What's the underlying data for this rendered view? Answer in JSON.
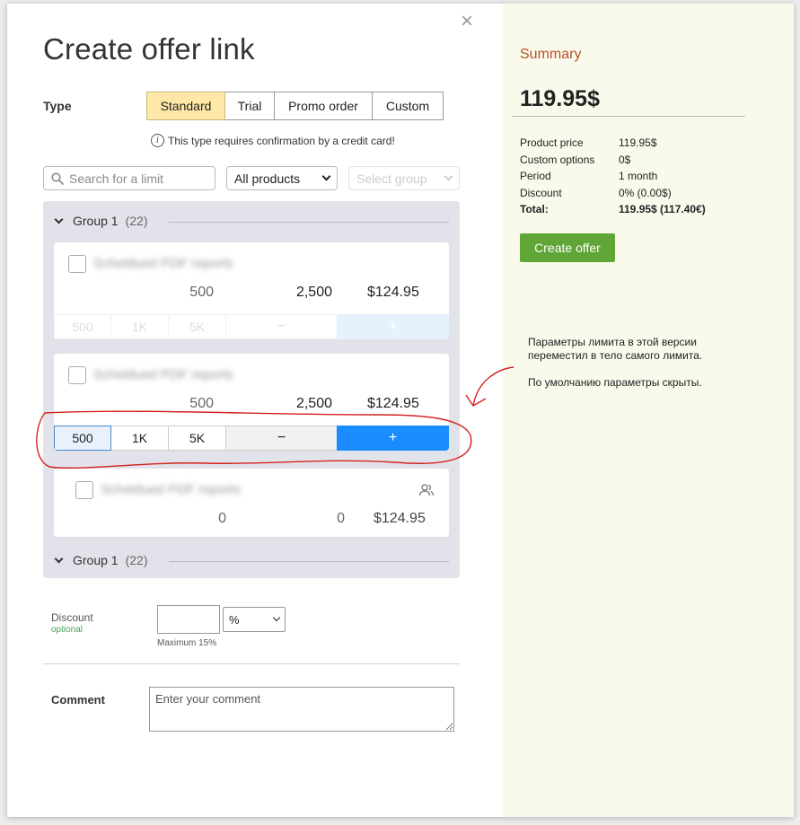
{
  "modal": {
    "close": "×",
    "title": "Create offer link"
  },
  "type": {
    "label": "Type",
    "options": [
      "Standard",
      "Trial",
      "Promo order",
      "Custom"
    ],
    "selected": "Standard",
    "note": "This type requires confirmation by a credit card!"
  },
  "filters": {
    "search_placeholder": "Search for a limit",
    "products": "All products",
    "group_placeholder": "Select group"
  },
  "groups": [
    {
      "name": "Group 1",
      "count": "(22)"
    },
    {
      "name": "Group 1",
      "count": "(22)"
    }
  ],
  "limits": [
    {
      "name": "Scheldued PDF reports",
      "current": "500",
      "total": "2,500",
      "price": "$124.95",
      "steps": [
        "500",
        "1K",
        "5K"
      ],
      "minus": "−",
      "plus": "+"
    },
    {
      "name": "Scheldued PDF reports",
      "current": "500",
      "total": "2,500",
      "price": "$124.95",
      "steps": [
        "500",
        "1K",
        "5K"
      ],
      "minus": "−",
      "plus": "+"
    },
    {
      "name": "Scheldued PDF reports",
      "current": "0",
      "total": "0",
      "price": "$124.95"
    }
  ],
  "discount": {
    "label": "Discount",
    "optional": "optional",
    "value": "",
    "unit": "%",
    "max": "Maximum 15%"
  },
  "comment": {
    "label": "Comment",
    "placeholder": "Enter your comment"
  },
  "summary": {
    "title": "Summary",
    "total": "119.95$",
    "rows": [
      {
        "label": "Product price",
        "value": "119.95$"
      },
      {
        "label": "Custom options",
        "value": "0$"
      },
      {
        "label": "Period",
        "value": "1 month"
      },
      {
        "label": "Discount",
        "value": "0% (0.00$)"
      },
      {
        "label": "Total:",
        "value": "119.95$ (117.40€)"
      }
    ],
    "button": "Create offer"
  },
  "annotation": {
    "line1": "Параметры лимита в этой версии",
    "line2": "переместил в тело самого лимита.",
    "line3": "По умолчанию параметры скрыты."
  },
  "colors": {
    "selected_type": "#fde8a7",
    "summary_bg": "#fafaec",
    "summary_title": "#b5532a",
    "create_button": "#5fa538",
    "plus_button": "#1a8cff",
    "annotation_red": "#d42020"
  }
}
